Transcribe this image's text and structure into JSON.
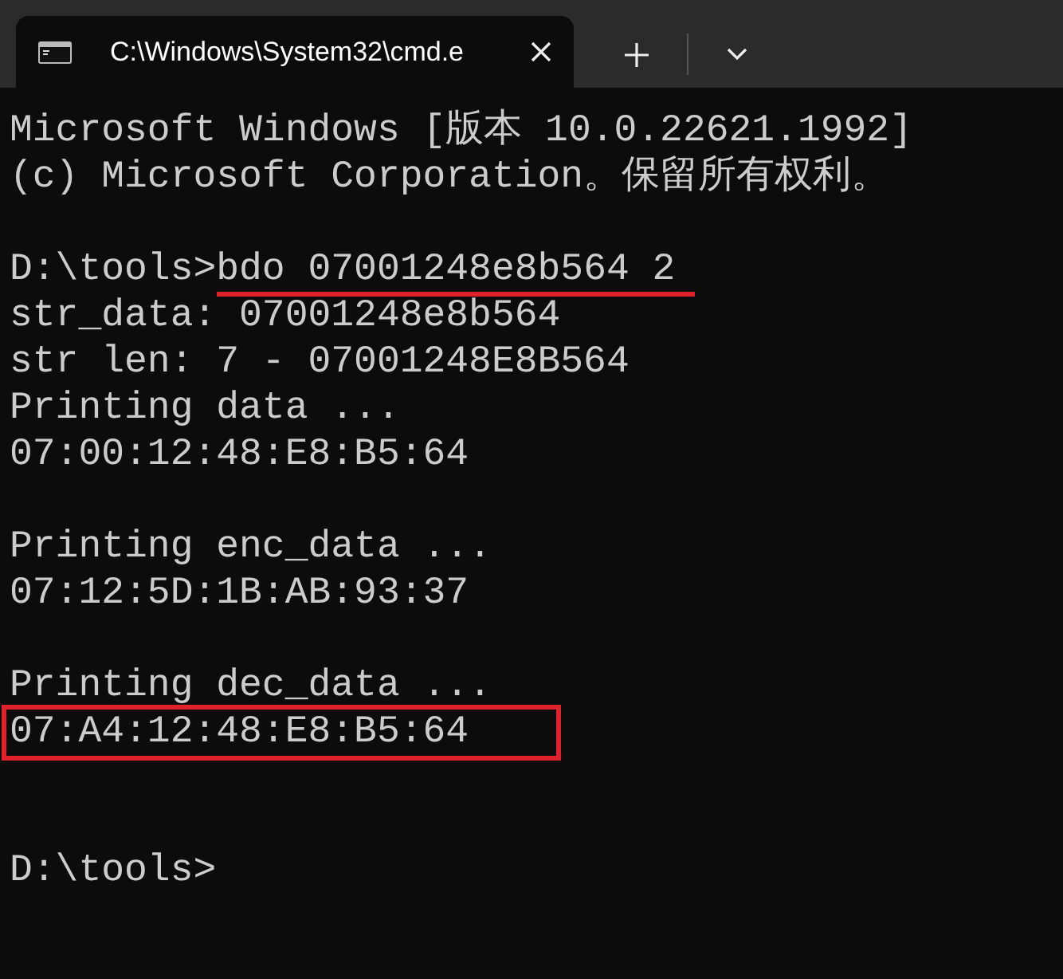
{
  "tabs": [
    {
      "title": "C:\\Windows\\System32\\cmd.e",
      "selected": true
    }
  ],
  "lines": [
    {
      "kind": "output",
      "text": "Microsoft Windows [版本 10.0.22621.1992]"
    },
    {
      "kind": "output",
      "text": "(c) Microsoft Corporation。保留所有权利。"
    },
    {
      "kind": "blank"
    },
    {
      "kind": "prompt",
      "prompt": "D:\\tools>",
      "command": "bdo 07001248e8b564 2",
      "underlined": true
    },
    {
      "kind": "output",
      "text": "str_data: 07001248e8b564"
    },
    {
      "kind": "output",
      "text": "str len: 7 - 07001248E8B564"
    },
    {
      "kind": "output",
      "text": "Printing data ..."
    },
    {
      "kind": "output",
      "text": "07:00:12:48:E8:B5:64"
    },
    {
      "kind": "blank"
    },
    {
      "kind": "output",
      "text": "Printing enc_data ..."
    },
    {
      "kind": "output",
      "text": "07:12:5D:1B:AB:93:37"
    },
    {
      "kind": "blank"
    },
    {
      "kind": "output",
      "text": "Printing dec_data ..."
    },
    {
      "kind": "output",
      "text": "07:A4:12:48:E8:B5:64",
      "boxed": true
    },
    {
      "kind": "blank"
    },
    {
      "kind": "blank"
    },
    {
      "kind": "prompt",
      "prompt": "D:\\tools>"
    }
  ]
}
